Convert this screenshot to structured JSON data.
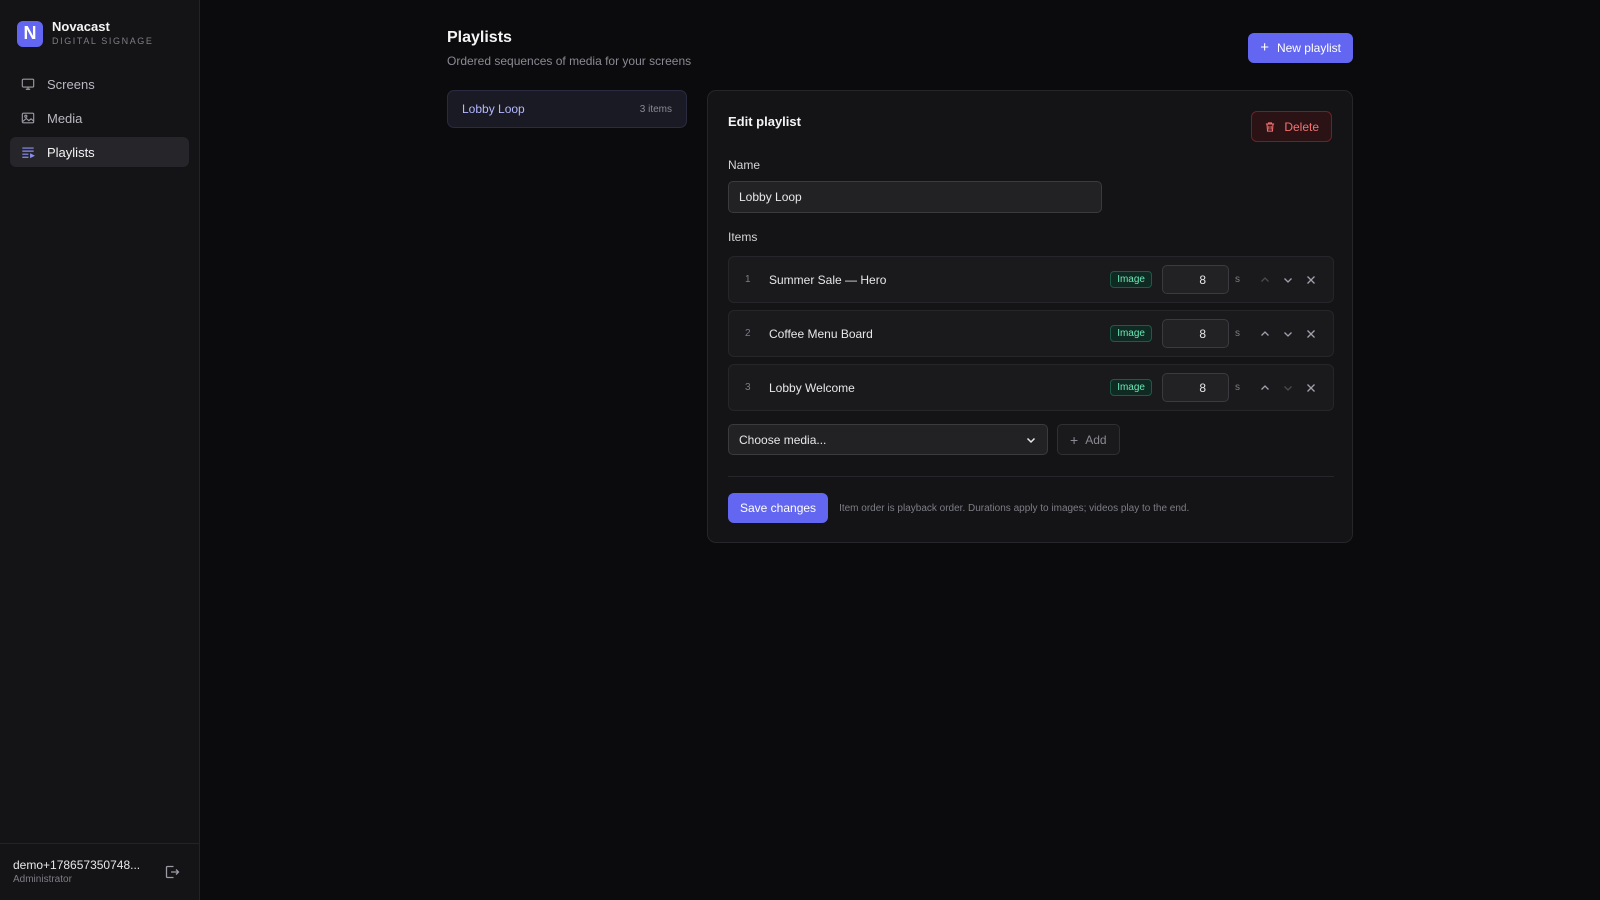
{
  "brand": {
    "logo_letter": "N",
    "name": "Novacast",
    "subtitle": "DIGITAL SIGNAGE",
    "accent": "#6366f1"
  },
  "sidebar": {
    "items": [
      {
        "label": "Screens",
        "icon": "monitor-icon",
        "active": false
      },
      {
        "label": "Media",
        "icon": "image-icon",
        "active": false
      },
      {
        "label": "Playlists",
        "icon": "playlist-icon",
        "active": true
      }
    ],
    "user": {
      "email": "demo+178657350748...",
      "role": "Administrator"
    }
  },
  "page": {
    "title": "Playlists",
    "subtitle": "Ordered sequences of media for your screens",
    "new_button": "New playlist"
  },
  "playlists": [
    {
      "name": "Lobby Loop",
      "count": "3 items"
    }
  ],
  "editor": {
    "title": "Edit playlist",
    "delete_label": "Delete",
    "name_label": "Name",
    "name_value": "Lobby Loop",
    "items_label": "Items",
    "items": [
      {
        "index": "1",
        "name": "Summer Sale — Hero",
        "type": "Image",
        "duration": "8",
        "unit": "s"
      },
      {
        "index": "2",
        "name": "Coffee Menu Board",
        "type": "Image",
        "duration": "8",
        "unit": "s"
      },
      {
        "index": "3",
        "name": "Lobby Welcome",
        "type": "Image",
        "duration": "8",
        "unit": "s"
      }
    ],
    "media_select": "Choose media...",
    "add_label": "Add",
    "save_label": "Save changes",
    "hint": "Item order is playback order. Durations apply to images; videos play to the end."
  }
}
